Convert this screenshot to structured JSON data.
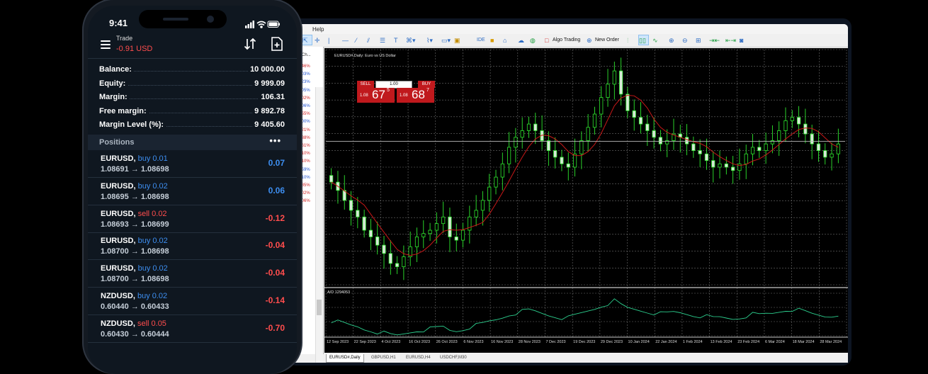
{
  "phone": {
    "status_time": "9:41",
    "header_title": "Trade",
    "header_pnl": "-0.91 USD",
    "account": [
      {
        "label": "Balance:",
        "value": "10 000.00"
      },
      {
        "label": "Equity:",
        "value": "9 999.09"
      },
      {
        "label": "Margin:",
        "value": "106.31"
      },
      {
        "label": "Free margin:",
        "value": "9 892.78"
      },
      {
        "label": "Margin Level (%):",
        "value": "9 405.60"
      }
    ],
    "positions_title": "Positions",
    "positions_more": "•••",
    "positions": [
      {
        "symbol": "EURUSD,",
        "side": "buy 0.01",
        "type": "buy",
        "prices": "1.08691 → 1.08698",
        "pl": "0.07"
      },
      {
        "symbol": "EURUSD,",
        "side": "buy 0.02",
        "type": "buy",
        "prices": "1.08695 → 1.08698",
        "pl": "0.06"
      },
      {
        "symbol": "EURUSD,",
        "side": "sell 0.02",
        "type": "sell",
        "prices": "1.08693 → 1.08699",
        "pl": "-0.12"
      },
      {
        "symbol": "EURUSD,",
        "side": "buy 0.02",
        "type": "buy",
        "prices": "1.08700 → 1.08698",
        "pl": "-0.04"
      },
      {
        "symbol": "EURUSD,",
        "side": "buy 0.02",
        "type": "buy",
        "prices": "1.08700 → 1.08698",
        "pl": "-0.04"
      },
      {
        "symbol": "NZDUSD,",
        "side": "buy 0.02",
        "type": "buy",
        "prices": "0.60440 → 0.60433",
        "pl": "-0.14"
      },
      {
        "symbol": "NZDUSD,",
        "side": "sell 0.05",
        "type": "sell",
        "prices": "0.60430 → 0.60444",
        "pl": "-0.70"
      }
    ]
  },
  "terminal": {
    "menu_help": "Help",
    "toolbar": {
      "ide": "IDE",
      "algo": "Algo Trading",
      "new_order": "New Order"
    },
    "nav_header": "Ch...",
    "nav_changes": [
      {
        "v": ".46%",
        "c": "red"
      },
      {
        "v": ".03%",
        "c": "blue"
      },
      {
        "v": ".23%",
        "c": "blue"
      },
      {
        "v": ".05%",
        "c": "blue"
      },
      {
        "v": ".02%",
        "c": "red"
      },
      {
        "v": ".06%",
        "c": "blue"
      },
      {
        "v": ".55%",
        "c": "red"
      },
      {
        "v": ".00%",
        "c": "blue"
      },
      {
        "v": ".21%",
        "c": "red"
      },
      {
        "v": ".38%",
        "c": "red"
      },
      {
        "v": ".61%",
        "c": "red"
      },
      {
        "v": ".10%",
        "c": "red"
      },
      {
        "v": ".10%",
        "c": "red"
      },
      {
        "v": ".59%",
        "c": "blue"
      },
      {
        "v": ".10%",
        "c": "blue"
      },
      {
        "v": ".85%",
        "c": "red"
      },
      {
        "v": ".02%",
        "c": "red"
      },
      {
        "v": ".06%",
        "c": "red"
      }
    ],
    "chart_title": "EURUSD#,Daily: Euro vs US Dollar",
    "sell_label": "SELL",
    "buy_label": "BUY",
    "lot": "1.00",
    "sell_small": "1.08",
    "sell_big": "67",
    "sell_exp": "5",
    "buy_small": "1.08",
    "buy_big": "68",
    "buy_exp": "7",
    "indicator_label": "A/D 1294053",
    "tabs": [
      "EURUSD#,Daily",
      "GBPUSD,H1",
      "EURUSD,H4",
      "USDCHF,M30"
    ],
    "colors": {
      "bull": "#2ee82e",
      "bear": "#d6e8d6",
      "ma": "#c81818",
      "grid": "#6e6e6e"
    }
  },
  "chart_data": {
    "type": "line",
    "x_labels": [
      "12 Sep 2023",
      "22 Sep 2023",
      "4 Oct 2023",
      "16 Oct 2023",
      "26 Oct 2023",
      "6 Nov 2023",
      "16 Nov 2023",
      "28 Nov 2023",
      "7 Dec 2023",
      "19 Dec 2023",
      "29 Dec 2023",
      "10 Jan 2024",
      "22 Jan 2024",
      "1 Feb 2024",
      "13 Feb 2024",
      "23 Feb 2024",
      "6 Mar 2024",
      "18 Mar 2024",
      "28 Mar 2024"
    ],
    "x_labels_shown": [
      "12 Sep 2023",
      "22 Sep 2023",
      "4 Oct 2023",
      "16 Oct 2023",
      "26 Oct 2023",
      "6 Nov 2023",
      "16 Nov 2023",
      "28 Nov 2023",
      "7 Dec 2023",
      "19 Dec 2023",
      "29 Dec 2023",
      "10 Jan 2024",
      "22 Jan 2024",
      "1 Feb 2024",
      "13 Feb 2024",
      "23 Feb 2024",
      "6 Mar 2024",
      "18 Mar 2024",
      "28 Mar 2024"
    ],
    "closes": [
      1.0745,
      1.072,
      1.069,
      1.066,
      1.064,
      1.06,
      1.058,
      1.0555,
      1.053,
      1.05,
      1.049,
      1.052,
      1.055,
      1.058,
      1.059,
      1.06,
      1.062,
      1.064,
      1.058,
      1.057,
      1.06,
      1.064,
      1.066,
      1.069,
      1.073,
      1.076,
      1.08,
      1.085,
      1.088,
      1.09,
      1.092,
      1.09,
      1.087,
      1.084,
      1.082,
      1.08,
      1.079,
      1.083,
      1.087,
      1.091,
      1.095,
      1.1,
      1.104,
      1.108,
      1.101,
      1.096,
      1.094,
      1.092,
      1.09,
      1.088,
      1.086,
      1.087,
      1.089,
      1.088,
      1.086,
      1.084,
      1.083,
      1.081,
      1.079,
      1.08,
      1.079,
      1.078,
      1.08,
      1.083,
      1.085,
      1.084,
      1.086,
      1.087,
      1.09,
      1.093,
      1.094,
      1.092,
      1.089,
      1.086,
      1.084,
      1.082,
      1.083,
      1.086
    ]
  }
}
